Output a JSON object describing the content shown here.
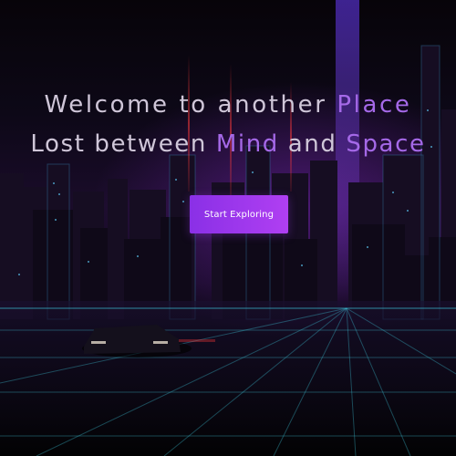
{
  "hero": {
    "line1": {
      "before": "Welcome to another ",
      "highlight": "Place"
    },
    "line2": {
      "before": "Lost between ",
      "highlight1": "Mind",
      "middle": " and ",
      "highlight2": "Space"
    }
  },
  "cta": {
    "label": "Start Exploring"
  },
  "colors": {
    "headline_text": "#cfc6d8",
    "highlight_text": "#a569e8",
    "button_start": "#8a30e6",
    "button_end": "#b03ff2",
    "grid_line": "#3ec8dc",
    "beam": "#7a4dff"
  },
  "background": {
    "scene": "synthwave-city-road"
  }
}
